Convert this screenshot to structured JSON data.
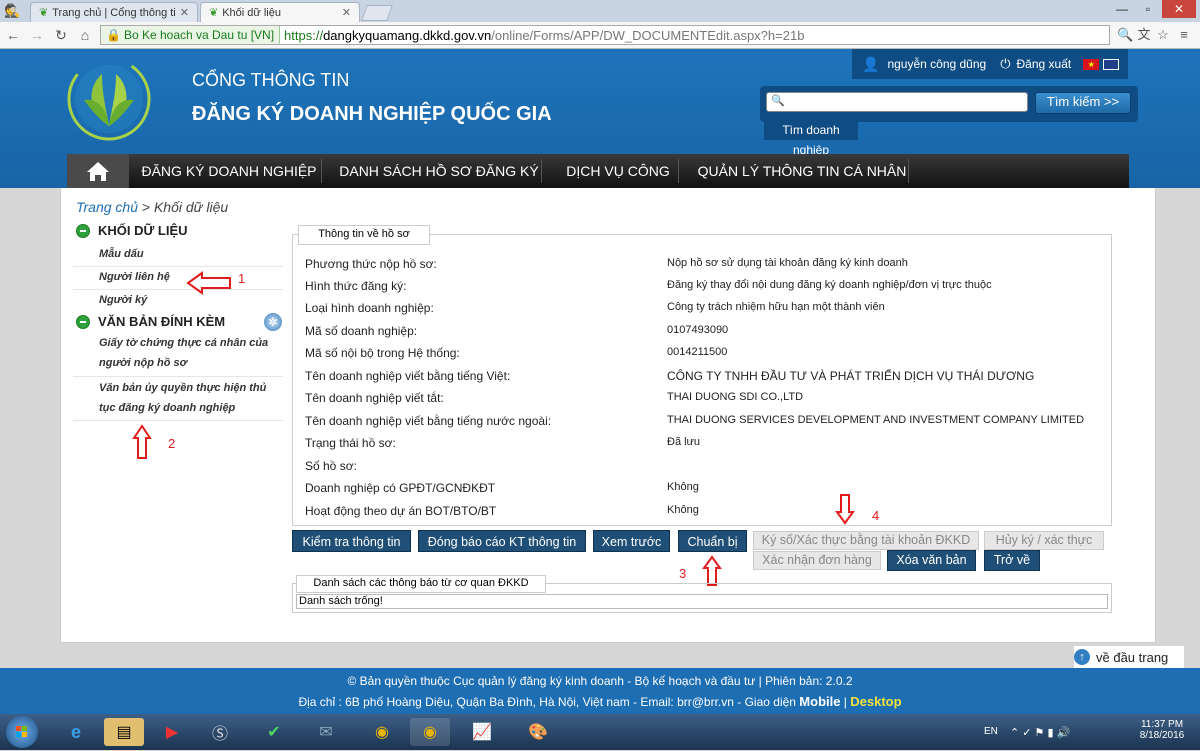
{
  "browser": {
    "tabs": [
      {
        "title": "Trang chủ | Cổng thông ti"
      },
      {
        "title": "Khối dữ liệu"
      }
    ],
    "ssl_badge": "Bo Ke hoach va Dau tu [VN]",
    "url_scheme": "https://",
    "url_host": "dangkyquamang.dkkd.gov.vn",
    "url_path": "/online/Forms/APP/DW_DOCUMENTEdit.aspx?h=21b"
  },
  "header": {
    "title_line1": "CỔNG THÔNG TIN",
    "title_line2": "ĐĂNG KÝ DOANH NGHIỆP QUỐC GIA",
    "user_name": "nguyễn công dũng",
    "logout": "Đăng xuất",
    "search_button": "Tìm kiếm >>",
    "search_business": "Tìm doanh nghiệp"
  },
  "menu": {
    "items": [
      {
        "label": "ĐĂNG KÝ DOANH NGHIỆP"
      },
      {
        "label": "DANH SÁCH HỒ SƠ ĐĂNG KÝ"
      },
      {
        "label": "DỊCH VỤ CÔNG"
      },
      {
        "label": "QUẢN LÝ THÔNG TIN CÁ NHÂN"
      }
    ]
  },
  "breadcrumb": {
    "home": "Trang chủ",
    "sep": " > ",
    "current": "Khối dữ liệu"
  },
  "sidebar": {
    "section1": "KHỐI DỮ LIỆU",
    "items1": [
      {
        "label": "Mẫu dấu"
      },
      {
        "label": "Người liên hệ"
      },
      {
        "label": "Người ký"
      }
    ],
    "section2": "VĂN BẢN ĐÍNH KÈM",
    "items2": [
      {
        "line1": "Giấy tờ chứng thực cá nhân của",
        "line2": "người nộp hồ sơ"
      },
      {
        "line1": "Văn bản ủy quyền thực hiện thủ",
        "line2": "tục đăng ký doanh nghiệp"
      }
    ]
  },
  "annotations": {
    "n1": "1",
    "n2": "2",
    "n3": "3",
    "n4": "4"
  },
  "info": {
    "legend": "Thông tin về hồ sơ",
    "rows": [
      {
        "label": "Phương thức nộp hồ sơ:",
        "value": "Nộp hồ sơ sử dụng tài khoản đăng ký kinh doanh"
      },
      {
        "label": "Hình thức đăng ký:",
        "value": "Đăng ký thay đổi nội dung đăng ký doanh nghiệp/đơn vị trực thuộc"
      },
      {
        "label": "Loại hình doanh nghiệp:",
        "value": "Công ty trách nhiệm hữu hạn một thành viên"
      },
      {
        "label": "Mã số doanh nghiệp:",
        "value": "0107493090"
      },
      {
        "label": "Mã số nội bộ trong Hệ thống:",
        "value": "0014211500"
      },
      {
        "label": "Tên doanh nghiệp viết bằng tiếng Việt:",
        "value": "CÔNG TY TNHH ĐẦU TƯ VÀ PHÁT TRIỂN DỊCH VỤ THÁI DƯƠNG"
      },
      {
        "label": "Tên doanh nghiệp viết tắt:",
        "value": "THAI DUONG SDI CO.,LTD"
      },
      {
        "label": "Tên doanh nghiệp viết bằng tiếng nước ngoài:",
        "value": "THAI DUONG SERVICES DEVELOPMENT AND INVESTMENT COMPANY LIMITED"
      },
      {
        "label": "Trạng thái hồ sơ:",
        "value": "Đã lưu"
      },
      {
        "label": "Số hồ sơ:",
        "value": ""
      },
      {
        "label": "Doanh nghiệp có GPĐT/GCNĐKĐT",
        "value": "Không"
      },
      {
        "label": "Hoạt động theo dự án BOT/BTO/BT",
        "value": "Không"
      }
    ]
  },
  "actions": {
    "check_info": "Kiểm tra thông tin",
    "close_report": "Đóng báo cáo KT thông tin",
    "preview": "Xem trước",
    "prepare": "Chuẩn bị",
    "sign": "Ký số/Xác thực bằng tài khoản ĐKKD",
    "cancel_sign": "Hủy ký / xác thực",
    "confirm_order": "Xác nhận đơn hàng",
    "delete_doc": "Xóa văn bản",
    "back": "Trở về"
  },
  "notices": {
    "legend": "Danh sách các thông báo từ cơ quan ĐKKD",
    "empty": "Danh sách trống!"
  },
  "back_to_top": "về đầu trang",
  "footer": {
    "line1": "© Bản quyền thuộc Cục quản lý đăng ký kinh doanh - Bộ kế hoạch và đầu tư | Phiên bản: 2.0.2",
    "line2_prefix": "Địa chỉ : 6B phố Hoàng Diệu, Quận Ba Đình, Hà Nội, Việt nam - Email: brr@brr.vn - Giao diện ",
    "mobile": "Mobile",
    "separator": " | ",
    "desktop": "Desktop"
  },
  "taskbar": {
    "lang": "EN",
    "time": "11:37 PM",
    "date": "8/18/2016"
  },
  "colors": {
    "header_blue": "#1d6eb3",
    "button_navy": "#1f4f76",
    "annotation_red": "#e21b1b",
    "desktop_yellow": "#f3e23a"
  }
}
